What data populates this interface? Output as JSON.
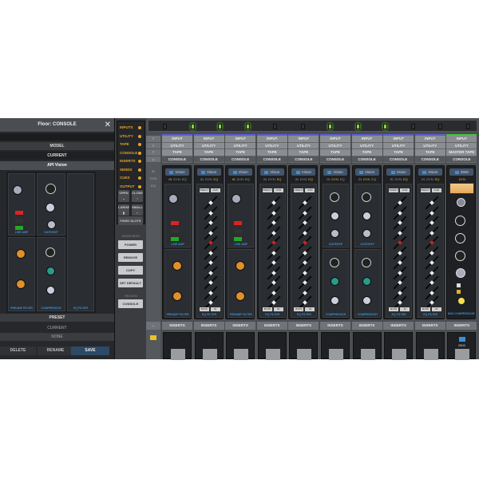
{
  "floor_panel": {
    "title": "Floor: CONSOLE",
    "close_icon": "close-x",
    "model_label": "MODEL",
    "current_label": "CURRENT",
    "current_model": "API Vision",
    "modules": [
      "LINE AMP",
      "GATE/EXP",
      "EQ FILTER",
      "PREAMP FILTER",
      "COMPRESSOR"
    ],
    "preset_label": "PRESET",
    "preset_current_label": "CURRENT",
    "preset_value": "NONE",
    "buttons": {
      "delete": "DELETE",
      "rename": "RENAME",
      "save": "SAVE"
    }
  },
  "sidebar": {
    "categories": [
      "INPUTS",
      "UTILITY",
      "TAPE",
      "CONSOLE",
      "INSERTS",
      "SENDS",
      "CUES",
      "OUTPUT"
    ],
    "open": "OPEN",
    "close": "CLOSE",
    "large": "LARGE",
    "small": "SMALL",
    "fixed_slots": "FIXED SLOTS",
    "modifiers_label": "MODIFIERS",
    "power": "POWER",
    "remove": "REMOVE",
    "copy": "COPY",
    "set_default": "SET DEFAULT",
    "region_label": "REGION",
    "console": "CONSOLE"
  },
  "mixer": {
    "meter_leds": [
      false,
      true,
      true,
      true,
      false,
      false,
      true,
      true,
      true,
      false,
      false,
      false
    ],
    "accent_color": "#5a5fd6",
    "master_color": "#3fc83a",
    "row_labels": [
      "INPUT",
      "UTILITY",
      "TAPE",
      "CONSOLE"
    ],
    "strip_mode_labels": [
      "IN",
      "DYN",
      "EQ"
    ],
    "inserts_label": "INSERTS",
    "channels": [
      {
        "type": "pre",
        "plugin": "Vision",
        "active": "IN",
        "tape": "TAPE",
        "mods": [
          "LINE AMP",
          "PREAMP FILTER"
        ]
      },
      {
        "type": "eq",
        "plugin": "Vision",
        "active": "EQ",
        "tape": "TAPE",
        "mods": [
          "EQ FILTER"
        ]
      },
      {
        "type": "pre",
        "plugin": "Vision",
        "active": "IN",
        "tape": "TAPE",
        "mods": [
          "LINE AMP",
          "PREAMP FILTER"
        ]
      },
      {
        "type": "eq",
        "plugin": "Vision",
        "active": "EQ",
        "tape": "TAPE",
        "mods": [
          "EQ FILTER"
        ]
      },
      {
        "type": "eq",
        "plugin": "Vision",
        "active": "EQ",
        "tape": "TAPE",
        "mods": [
          "EQ FILTER"
        ]
      },
      {
        "type": "dyn",
        "plugin": "Vision",
        "active": "DYN",
        "tape": "TAPE",
        "mods": [
          "GATE/EXP",
          "COMPRESSOR"
        ]
      },
      {
        "type": "dyn",
        "plugin": "Vision",
        "active": "DYN",
        "tape": "TAPE",
        "mods": [
          "GATE/EXP",
          "COMPRESSOR"
        ]
      },
      {
        "type": "eq",
        "plugin": "Vision",
        "active": "EQ",
        "tape": "TAPE",
        "mods": [
          "EQ FILTER"
        ]
      },
      {
        "type": "eq",
        "plugin": "Vision",
        "active": "EQ",
        "tape": "TAPE",
        "mods": [
          "EQ FILTER"
        ]
      },
      {
        "type": "master",
        "plugin": "2500",
        "active": "DYN",
        "tape": "MASTER TAPE",
        "mods": [
          "BUS COMPRESSOR"
        ],
        "insert": "2500"
      }
    ],
    "eq_top_buttons": [
      "PREFLT",
      "OVR"
    ],
    "eq_bottom_buttons": [
      "BYPS",
      "IN"
    ]
  }
}
